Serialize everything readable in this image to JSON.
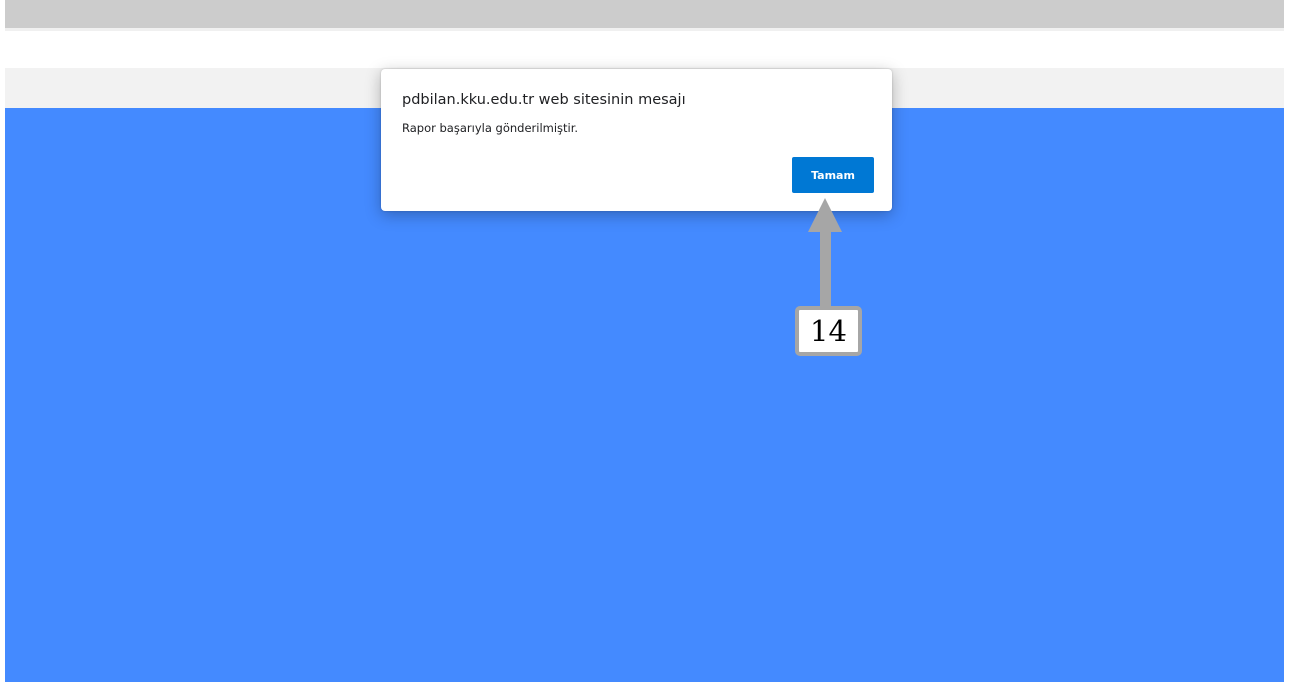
{
  "colors": {
    "page_blue": "#448aff",
    "button_blue": "#0078d4",
    "annotation_gray": "#a6a6a6"
  },
  "dialog": {
    "title": "pdbilan.kku.edu.tr web sitesinin mesajı",
    "message": "Rapor başarıyla gönderilmiştir.",
    "ok_label": "Tamam"
  },
  "annotation": {
    "step_number": "14",
    "icon": "up-arrow-icon"
  }
}
